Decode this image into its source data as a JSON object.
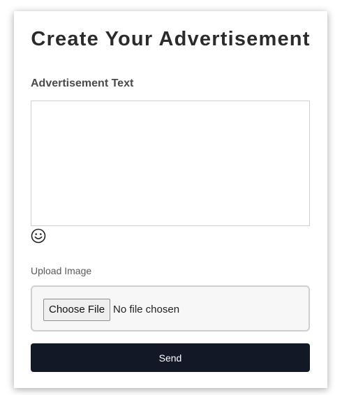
{
  "form": {
    "title": "Create Your Advertisement",
    "ad_text_label": "Advertisement Text",
    "ad_text_value": "",
    "emoji_icon": "smiley-face-icon",
    "upload_label": "Upload Image",
    "choose_file_label": "Choose File",
    "file_status": "No file chosen",
    "send_label": "Send"
  },
  "colors": {
    "send_button_bg": "#121826",
    "send_button_text": "#ffffff",
    "title_text": "#2b2b2b"
  }
}
